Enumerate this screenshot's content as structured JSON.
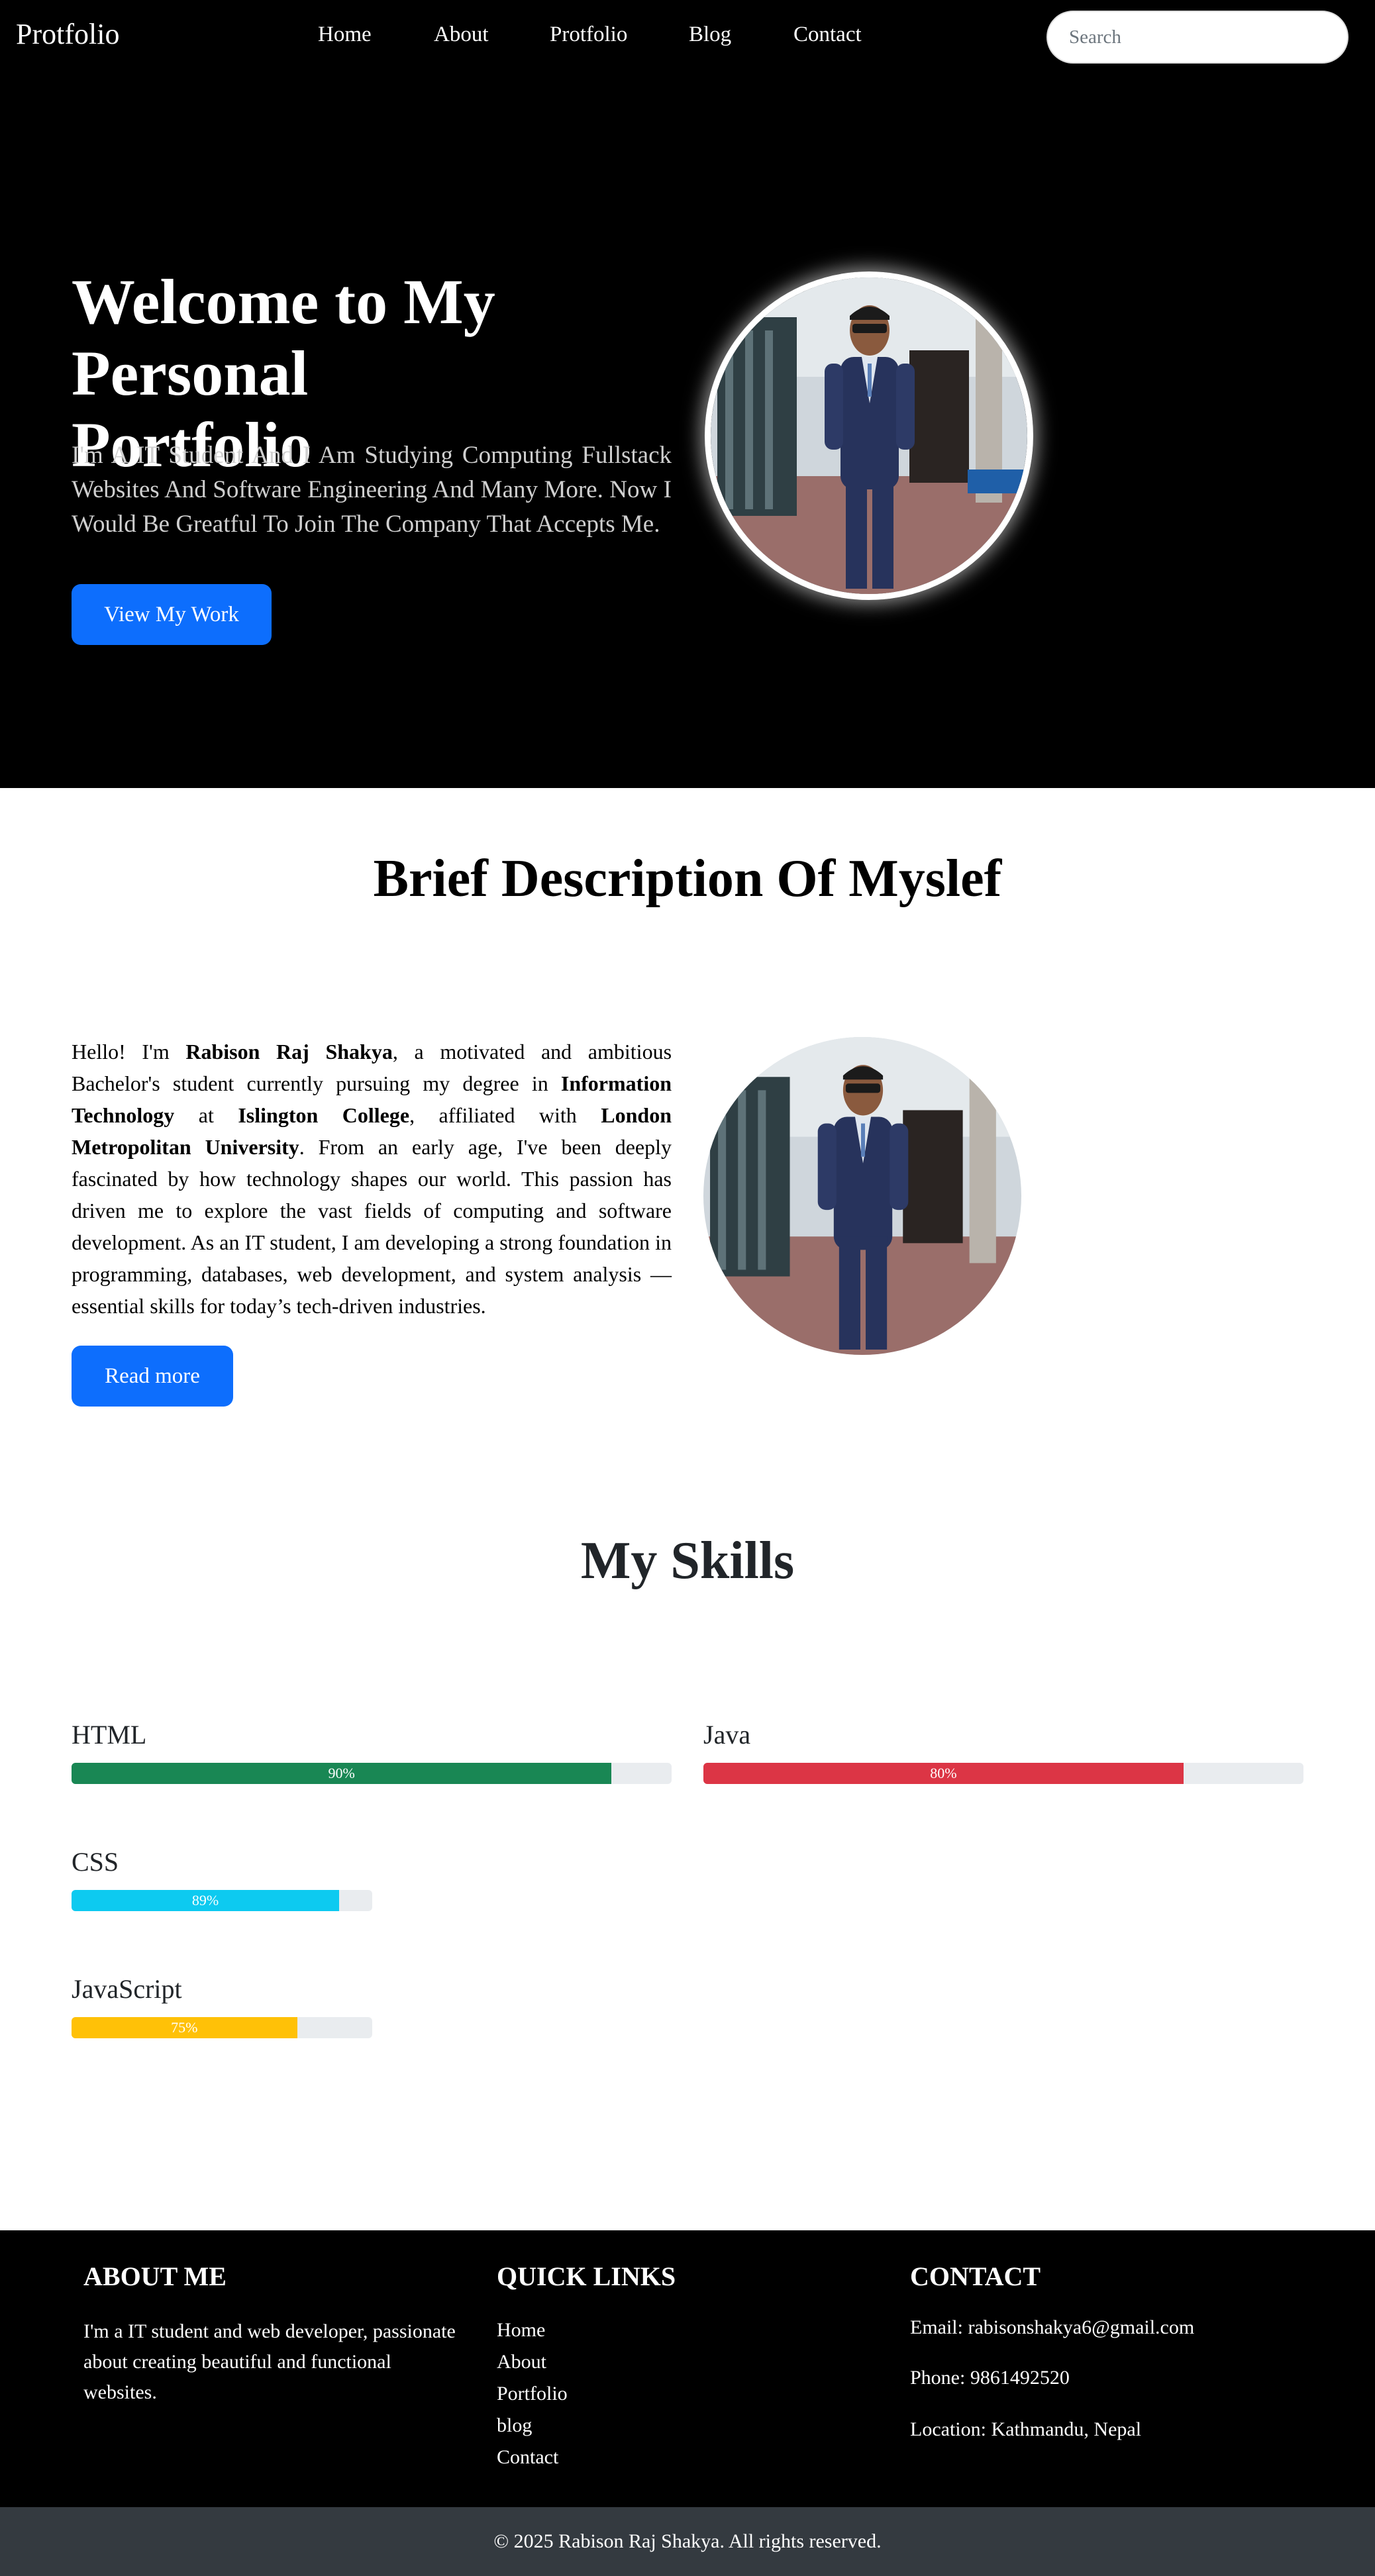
{
  "nav": {
    "brand": "Protfolio",
    "links": [
      "Home",
      "About",
      "Protfolio",
      "Blog",
      "Contact"
    ],
    "search_placeholder": "Search"
  },
  "hero": {
    "title": "Welcome to My Personal Portfolio",
    "text": "I'm A IT Student And I Am Studying Computing Fullstack Websites And Software Engineering And Many More. Now I Would Be Greatful To Join The Company That Accepts Me.",
    "button": "View My Work"
  },
  "about": {
    "title": "Brief Description Of Myslef",
    "t1": "Hello! I'm ",
    "name": "Rabison Raj Shakya",
    "t2": ", a motivated and ambitious Bachelor's student currently pursuing my degree in ",
    "degree": "Information Technology",
    "t3": " at ",
    "college": "Islington College",
    "t4": ", affiliated with ",
    "university": "London Metropolitan University",
    "t5": ". From an early age, I've been deeply fascinated by how technology shapes our world. This passion has driven me to explore the vast fields of computing and software development. As an IT student, I am developing a strong foundation in programming, databases, web development, and system analysis — essential skills for today’s tech-driven industries.",
    "button": "Read more"
  },
  "skills": {
    "title": "My Skills",
    "items": [
      {
        "name": "HTML",
        "percent": 90,
        "label": "90%",
        "color": "#198754"
      },
      {
        "name": "Java",
        "percent": 80,
        "label": "80%",
        "color": "#dc3545"
      },
      {
        "name": "CSS",
        "percent": 89,
        "label": "89%",
        "color": "#0dcaf0"
      },
      {
        "name": "JavaScript",
        "percent": 75,
        "label": "75%",
        "color": "#ffc107"
      }
    ]
  },
  "footer": {
    "about_title": "ABOUT ME",
    "about_text": "I'm a IT student and web developer, passionate about creating beautiful and functional websites.",
    "links_title": "QUICK LINKS",
    "links": [
      "Home",
      "About",
      "Portfolio",
      "blog",
      "Contact"
    ],
    "contact_title": "CONTACT",
    "email": "Email: rabisonshakya6@gmail.com",
    "phone": "Phone: 9861492520",
    "location": "Location: Kathmandu, Nepal",
    "copyright": "© 2025 Rabison Raj Shakya. All rights reserved."
  }
}
